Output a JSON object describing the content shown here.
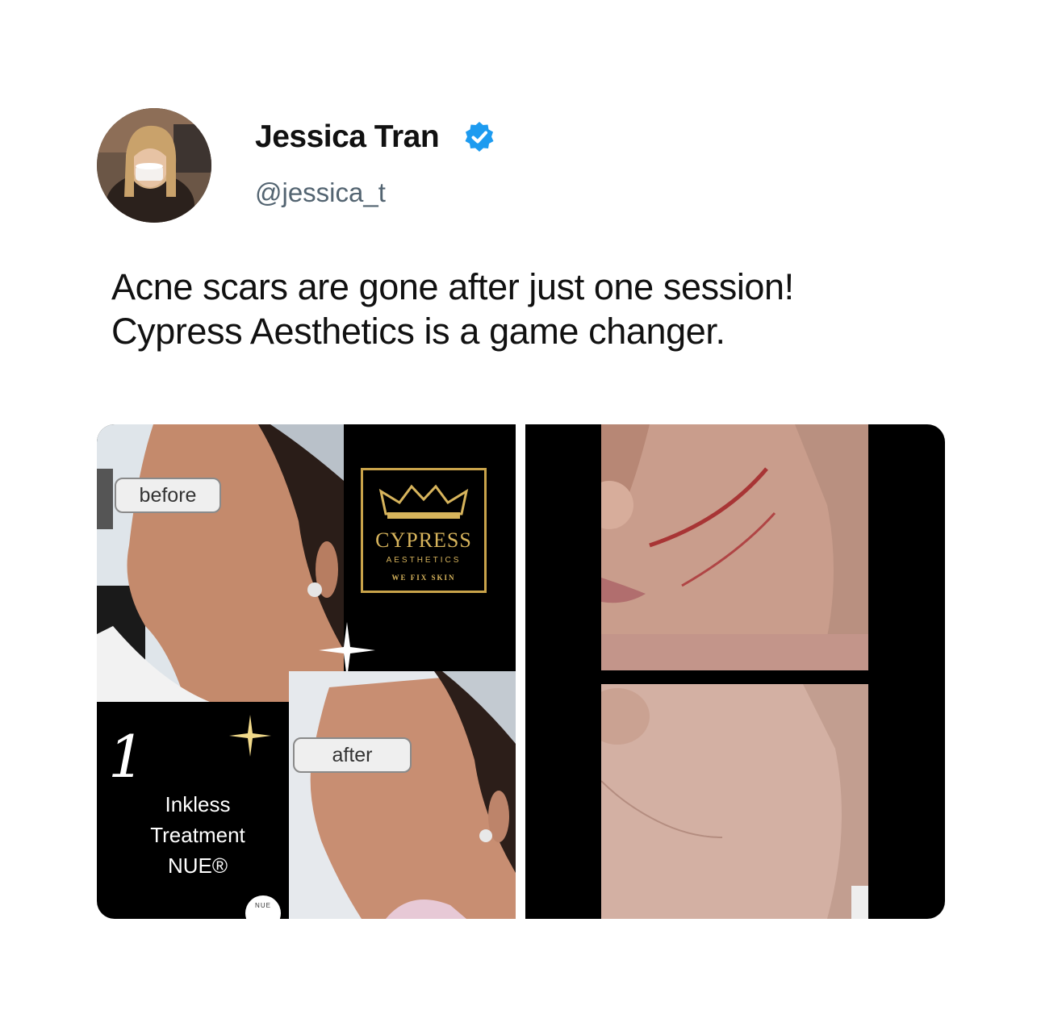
{
  "author": {
    "name": "Jessica Tran",
    "handle": "@jessica_t",
    "verified_color": "#1d9bf0"
  },
  "tweet": {
    "lines": [
      "Acne scars are gone after just one session!",
      "Cypress Aesthetics is a game changer."
    ]
  },
  "media_left": {
    "before_label": "before",
    "after_label": "after",
    "logo": {
      "name": "CYPRESS",
      "sub": "AESTHETICS",
      "tagline": "WE FIX SKIN",
      "color": "#d7b45c"
    },
    "promo": {
      "number": "1",
      "line1": "Inkless",
      "line2": "Treatment",
      "line3": "NUE®"
    },
    "badge": "NUE"
  }
}
